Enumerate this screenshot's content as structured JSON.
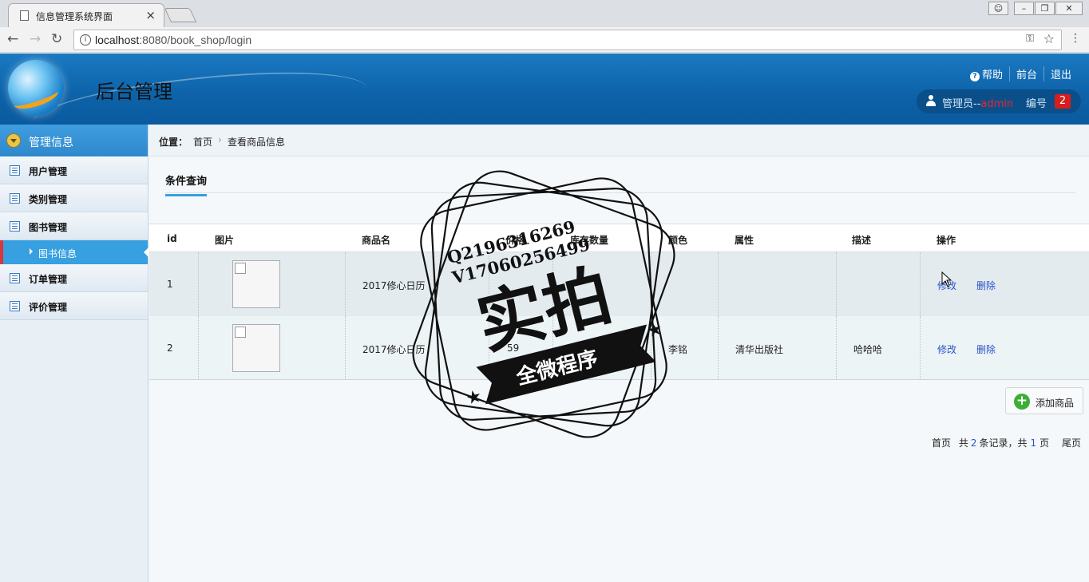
{
  "browser": {
    "tab_title": "信息管理系统界面",
    "tab_close": "×",
    "url_host": "localhost",
    "url_port_path": ":8080/book_shop/login"
  },
  "header": {
    "title": "后台管理",
    "links": [
      "帮助",
      "前台",
      "退出"
    ],
    "user_role": "管理员--",
    "user_name": "admin",
    "number_label": "编号",
    "number_value": "2"
  },
  "sidebar": {
    "section_title": "管理信息",
    "items": [
      {
        "label": "用户管理"
      },
      {
        "label": "类别管理"
      },
      {
        "label": "图书管理"
      },
      {
        "label": "订单管理"
      },
      {
        "label": "评价管理"
      }
    ],
    "active_sub": "图书信息"
  },
  "breadcrumb": {
    "position_label": "位置：",
    "home": "首页",
    "separator": "›",
    "current": "查看商品信息"
  },
  "tabs": {
    "query": "条件查询"
  },
  "table": {
    "columns": [
      "id",
      "图片",
      "商品名",
      "价格",
      "库存数量",
      "颜色",
      "属性",
      "描述",
      "操作"
    ],
    "rows": [
      {
        "id": "1",
        "name": "2017修心日历",
        "price": "",
        "stock": "",
        "color": "",
        "attr": "",
        "desc": "",
        "edit": "修改",
        "delete": "删除"
      },
      {
        "id": "2",
        "name": "2017修心日历",
        "price": "59",
        "stock": "",
        "color": "李铭",
        "attr": "清华出版社",
        "desc": "哈哈哈",
        "edit": "修改",
        "delete": "删除"
      }
    ]
  },
  "add_button": "添加商品",
  "pager": {
    "first": "首页",
    "total_prefix": "共",
    "total_records": "2",
    "records_suffix": "条记录，共",
    "total_pages": "1",
    "pages_suffix": "页",
    "last": "尾页"
  },
  "watermark": {
    "line1": "Q2196316269",
    "line2": "V17060256499",
    "big": "实拍",
    "banner": "全微程序"
  }
}
